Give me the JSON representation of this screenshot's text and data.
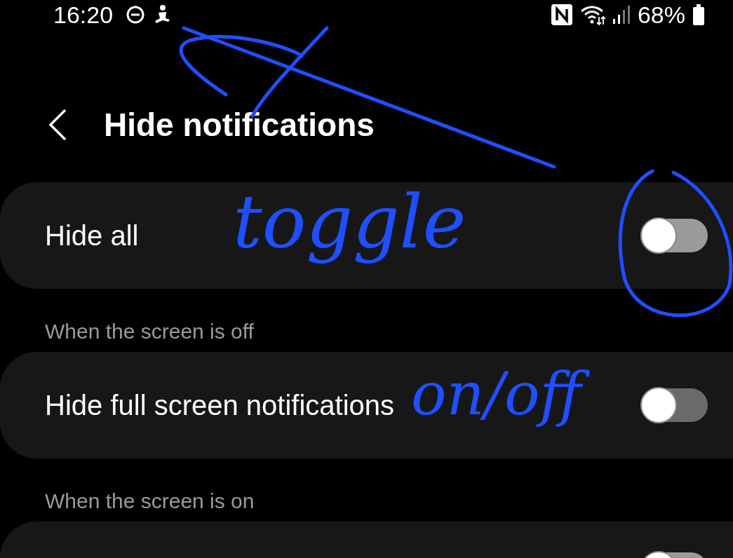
{
  "status_bar": {
    "time": "16:20",
    "battery": "68%"
  },
  "header": {
    "title": "Hide notifications"
  },
  "sections": [
    {
      "rows": [
        {
          "label": "Hide all",
          "checked": false,
          "disabled": false
        }
      ]
    },
    {
      "heading": "When the screen is off",
      "rows": [
        {
          "label": "Hide full screen notifications",
          "checked": false,
          "disabled": true
        }
      ]
    },
    {
      "heading": "When the screen is on",
      "rows": [
        {
          "checked": false,
          "disabled": false
        }
      ]
    }
  ],
  "annotation": {
    "texts": [
      "toggle",
      "on/off"
    ]
  }
}
